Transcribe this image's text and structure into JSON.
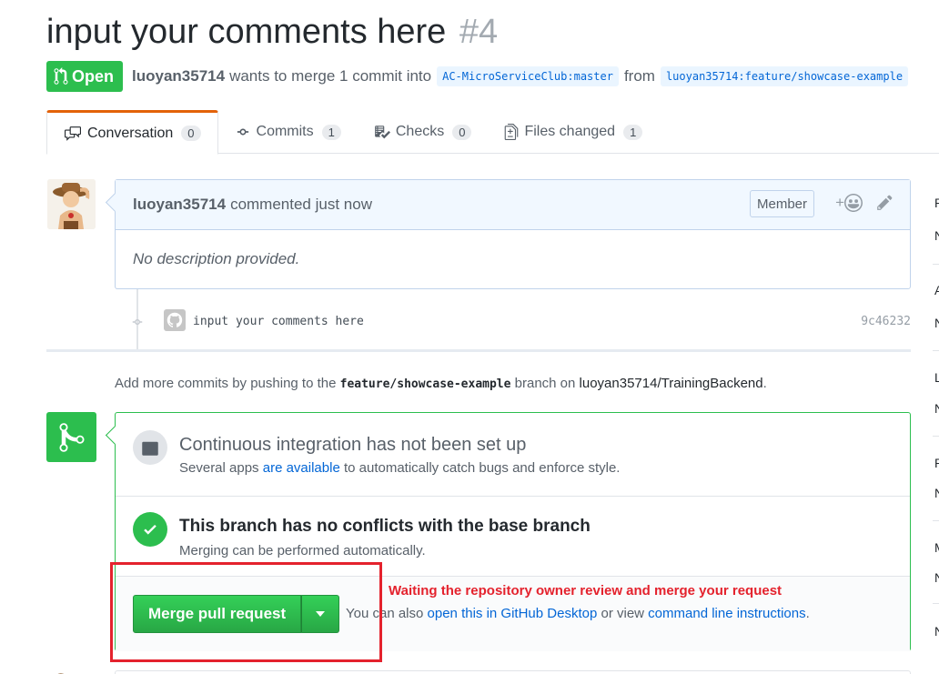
{
  "pr": {
    "title": "input your comments here",
    "number": "#4",
    "state": "Open",
    "author": "luoyan35714",
    "merge_text": "wants to merge 1 commit into",
    "base_ref": "AC-MicroServiceClub:master",
    "from_text": "from",
    "head_ref": "luoyan35714:feature/showcase-example"
  },
  "tabs": [
    {
      "label": "Conversation",
      "count": "0",
      "icon": "comment-discussion-icon"
    },
    {
      "label": "Commits",
      "count": "1",
      "icon": "git-commit-icon"
    },
    {
      "label": "Checks",
      "count": "0",
      "icon": "checklist-icon"
    },
    {
      "label": "Files changed",
      "count": "1",
      "icon": "file-diff-icon"
    }
  ],
  "comment": {
    "author": "luoyan35714",
    "action": "commented just now",
    "role": "Member",
    "react_plus": "+",
    "body": "No description provided."
  },
  "commit": {
    "message": "input your comments here",
    "sha": "9c46232"
  },
  "push_note": {
    "prefix": "Add more commits by pushing to the",
    "branch": "feature/showcase-example",
    "middle": "branch on",
    "repo": "luoyan35714/TrainingBackend",
    "suffix": "."
  },
  "ci": {
    "title": "Continuous integration has not been set up",
    "sub_prefix": "Several apps",
    "sub_link": "are available",
    "sub_suffix": "to automatically catch bugs and enforce style."
  },
  "conflicts": {
    "title": "This branch has no conflicts with the base branch",
    "sub": "Merging can be performed automatically."
  },
  "merge": {
    "button": "Merge pull request",
    "alt_prefix": "You can also",
    "alt_link1": "open this in GitHub Desktop",
    "alt_middle": "or view",
    "alt_link2": "command line instructions",
    "alt_suffix": "."
  },
  "annotation": "Waiting the repository owner review and merge your request",
  "sidebar_initials": [
    "R",
    "N",
    "A",
    "N",
    "L",
    "N",
    "P",
    "N",
    "M",
    "N",
    "N"
  ],
  "colors": {
    "open_green": "#2cbe4e",
    "annotation_red": "#e4222d",
    "link_blue": "#0366d6"
  }
}
